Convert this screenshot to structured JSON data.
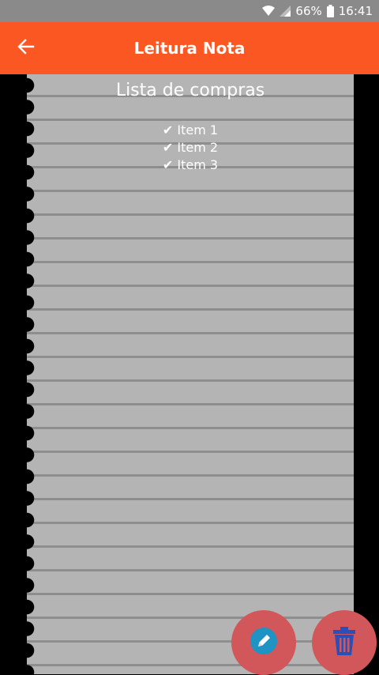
{
  "status_bar": {
    "battery_percent": "66%",
    "time": "16:41"
  },
  "app_bar": {
    "title": "Leitura Nota"
  },
  "note": {
    "title": "Lista de compras",
    "items": [
      "✔ Item 1",
      "✔ Item 2",
      "✔ Item 3"
    ]
  },
  "colors": {
    "app_bar": "#fb5722",
    "paper": "#b4b4b4",
    "fab": "#d2575a",
    "edit_icon": "#1f93c4",
    "delete_icon": "#2a4fb8"
  },
  "icons": {
    "back": "arrow-back-icon",
    "edit": "pencil-icon",
    "delete": "trash-icon",
    "wifi": "wifi-icon",
    "signal": "signal-icon",
    "battery": "battery-icon"
  }
}
